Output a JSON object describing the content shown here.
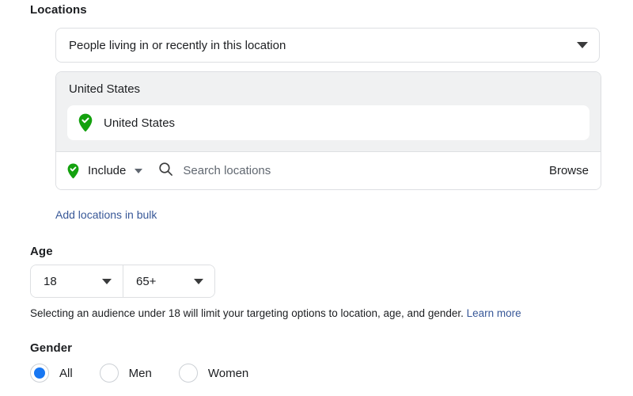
{
  "locations": {
    "heading": "Locations",
    "location_type_select": {
      "value": "People living in or recently in this location",
      "caret_icon": "chevron-down-icon"
    },
    "selected_group": {
      "title": "United States",
      "items": [
        {
          "label": "United States",
          "icon": "location-pin-check-icon"
        }
      ]
    },
    "include_control": {
      "icon": "location-pin-check-icon",
      "label": "Include",
      "caret_icon": "chevron-down-icon"
    },
    "search": {
      "icon": "search-icon",
      "placeholder": "Search locations",
      "value": ""
    },
    "browse_label": "Browse",
    "bulk_link_label": "Add locations in bulk"
  },
  "age": {
    "heading": "Age",
    "min": {
      "value": "18",
      "caret_icon": "chevron-down-icon"
    },
    "max": {
      "value": "65+",
      "caret_icon": "chevron-down-icon"
    },
    "helper_text": "Selecting an audience under 18 will limit your targeting options to location, age, and gender.",
    "helper_link_label": "Learn more"
  },
  "gender": {
    "heading": "Gender",
    "options": [
      {
        "label": "All",
        "selected": true
      },
      {
        "label": "Men",
        "selected": false
      },
      {
        "label": "Women",
        "selected": false
      }
    ]
  },
  "colors": {
    "link_blue": "#385898",
    "radio_blue": "#1877f2",
    "pin_green": "#13a10e",
    "panel_gray": "#f0f1f2",
    "border_gray": "#dddfe2",
    "text_primary": "#1c1e21",
    "text_secondary": "#606770"
  }
}
